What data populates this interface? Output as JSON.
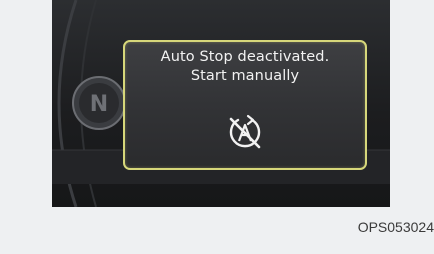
{
  "display": {
    "gear_indicator": "N",
    "message_line1": "Auto Stop deactivated.",
    "message_line2": "Start manually",
    "icon": "auto-stop-off-icon"
  },
  "figure_code": "OPS053024",
  "colors": {
    "popup_border": "#d6d77a",
    "screen_background": "#1c1d1f",
    "text": "#f2f2f2"
  }
}
